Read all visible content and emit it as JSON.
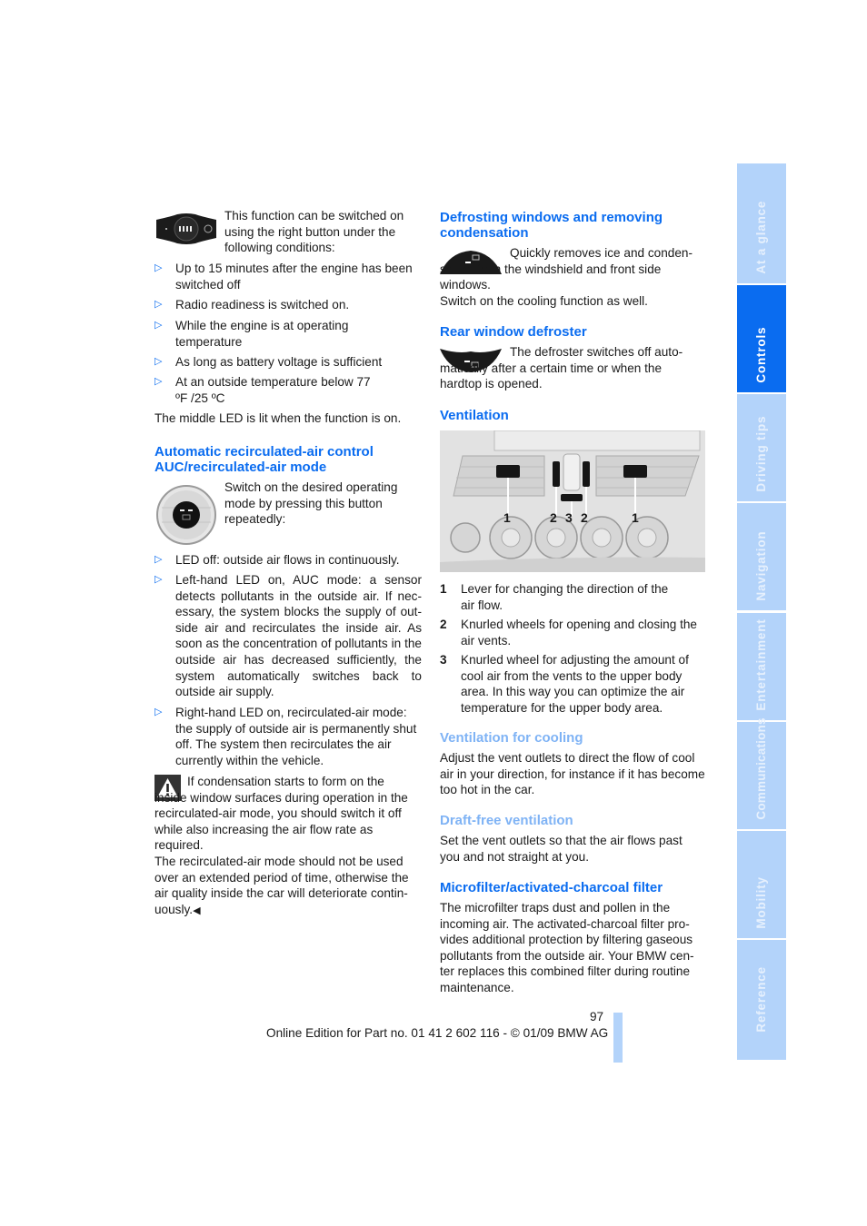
{
  "left_column": {
    "intro_text": "This function can be switched on using the right button under the following conditions:",
    "conditions": [
      "Up to 15 minutes after the engine has been switched off",
      "Radio readiness is switched on.",
      "While the engine is at operating temperature",
      "As long as battery voltage is sufficient",
      "At an outside temperature below 77 ºF /25 ºC"
    ],
    "led_note": "The middle LED is lit when the function is on.",
    "auc_heading": "Automatic recirculated-air control AUC/recirculated-air mode",
    "auc_intro": "Switch on the desired operating mode by pressing this button repeatedly:",
    "auc_modes": [
      "LED off: outside air flows in continuously.",
      "Left-hand LED on, AUC mode: a sensor detects pollutants in the outside air. If nec-essary, the system blocks the supply of out-side air and recirculates the inside air. As soon as the concentration of pollutants in the outside air has decreased sufficiently, the system automatically switches back to outside air supply.",
      "Right-hand LED on, recirculated-air mode: the supply of outside air is permanently shut off. The system then recirculates the air currently within the vehicle."
    ],
    "warning_text": "If condensation starts to form on the inside window surfaces during operation in the recirculated-air mode, you should switch it off while also increasing the air flow rate as required.",
    "warning_text_2": "The recirculated-air mode should not be used over an extended period of time, otherwise the air quality inside the car will deteriorate contin-uously.",
    "end_mark": "◀"
  },
  "right_column": {
    "defrost_heading": "Defrosting windows and removing condensation",
    "defrost_text": "Quickly removes ice and conden-sation from the windshield and front side windows.",
    "defrost_text_2": "Switch on the cooling function as well.",
    "rear_heading": "Rear window defroster",
    "rear_text": "The defroster switches off auto-matically after a certain time or when the hardtop is opened.",
    "ventilation_heading": "Ventilation",
    "figure_labels": [
      "1",
      "2",
      "3",
      "2",
      "1"
    ],
    "legend": [
      {
        "num": "1",
        "text": "Lever for changing the direction of the air flow."
      },
      {
        "num": "2",
        "text": "Knurled wheels for opening and closing the air vents."
      },
      {
        "num": "3",
        "text": "Knurled wheel for adjusting the amount of cool air from the vents to the upper body area. In this way you can optimize the air temperature for the upper body area."
      }
    ],
    "cooling_heading": "Ventilation for cooling",
    "cooling_text": "Adjust the vent outlets to direct the flow of cool air in your direction, for instance if it has become too hot in the car.",
    "draft_heading": "Draft-free ventilation",
    "draft_text": "Set the vent outlets so that the air flows past you and not straight at you.",
    "filter_heading": "Microfilter/activated-charcoal filter",
    "filter_text": "The microfilter traps dust and pollen in the incoming air. The activated-charcoal filter pro-vides additional protection by filtering gaseous pollutants from the outside air. Your BMW cen-ter replaces this combined filter during routine maintenance."
  },
  "footer": {
    "page_number": "97",
    "edition": "Online Edition for Part no. 01 41 2 602 116 - © 01/09 BMW AG"
  },
  "side_tabs": [
    {
      "label": "At a glance",
      "active": false
    },
    {
      "label": "Controls",
      "active": true
    },
    {
      "label": "Driving tips",
      "active": false
    },
    {
      "label": "Navigation",
      "active": false
    },
    {
      "label": "Entertainment",
      "active": false
    },
    {
      "label": "Communications",
      "active": false
    },
    {
      "label": "Mobility",
      "active": false
    },
    {
      "label": "Reference",
      "active": false
    }
  ],
  "colors": {
    "accent": "#0a6cf0",
    "subheading": "#7fb3f5",
    "tab": "#b3d3fa"
  }
}
